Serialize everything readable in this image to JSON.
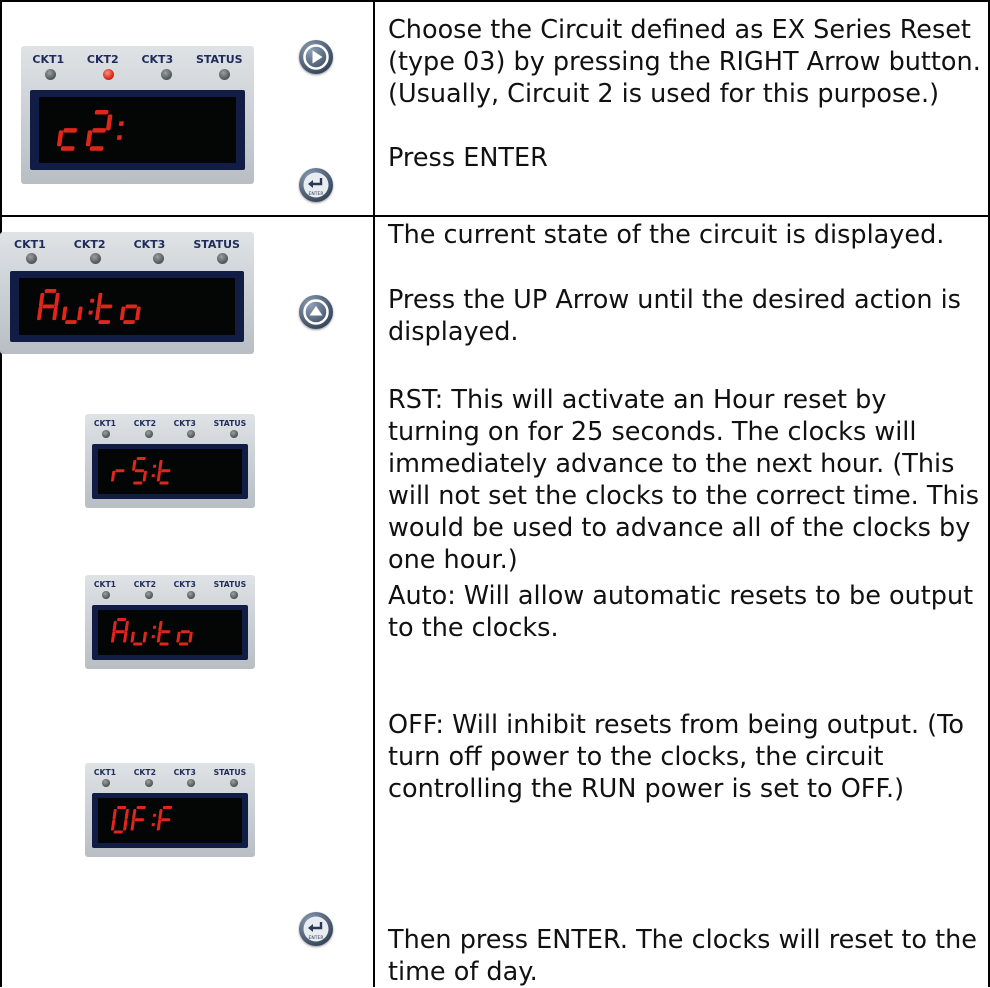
{
  "rows": [
    {
      "device": {
        "labels": [
          "CKT1",
          "CKT2",
          "CKT3",
          "STATUS"
        ],
        "active_led": 1,
        "display": "c2:"
      },
      "buttons": [
        "right-arrow-button",
        "enter-button"
      ],
      "text": {
        "p1": "Choose the Circuit defined as EX Series Reset (type 03) by pressing the RIGHT Arrow button. (Usually, Circuit 2 is used for this purpose.)",
        "p2": "Press ENTER"
      }
    },
    {
      "devices": [
        {
          "labels": [
            "CKT1",
            "CKT2",
            "CKT3",
            "STATUS"
          ],
          "active_led": null,
          "display": "Au:to"
        },
        {
          "labels": [
            "CKT1",
            "CKT2",
            "CKT3",
            "STATUS"
          ],
          "active_led": null,
          "display": "rS:t"
        },
        {
          "labels": [
            "CKT1",
            "CKT2",
            "CKT3",
            "STATUS"
          ],
          "active_led": null,
          "display": "Au:to"
        },
        {
          "labels": [
            "CKT1",
            "CKT2",
            "CKT3",
            "STATUS"
          ],
          "active_led": null,
          "display": "OF:F"
        }
      ],
      "buttons": [
        "up-arrow-button",
        "enter-button"
      ],
      "text": {
        "p1": "The current state of the circuit is displayed.",
        "p2": "Press the UP Arrow until the desired action is displayed.",
        "p3": "RST: This will activate an Hour reset by turning on for 25 seconds.  The clocks will immediately advance to the next hour. (This will not set the clocks to the correct time.  This would be used to advance all of the clocks by one hour.)",
        "p4": "Auto:  Will allow automatic resets to be output to the clocks.",
        "p5": "OFF:  Will inhibit resets from being output. (To turn off power to the clocks, the circuit controlling the RUN power is set to OFF.)",
        "p6": "Then press ENTER.  The clocks will reset to the time of day."
      }
    }
  ],
  "colors": {
    "led_on": "#d01b12",
    "segment": "#e0261b",
    "screen_bezel": "#121d46",
    "label": "#1f2b5a"
  },
  "icons": [
    "right-arrow-icon",
    "enter-icon",
    "up-arrow-icon"
  ]
}
